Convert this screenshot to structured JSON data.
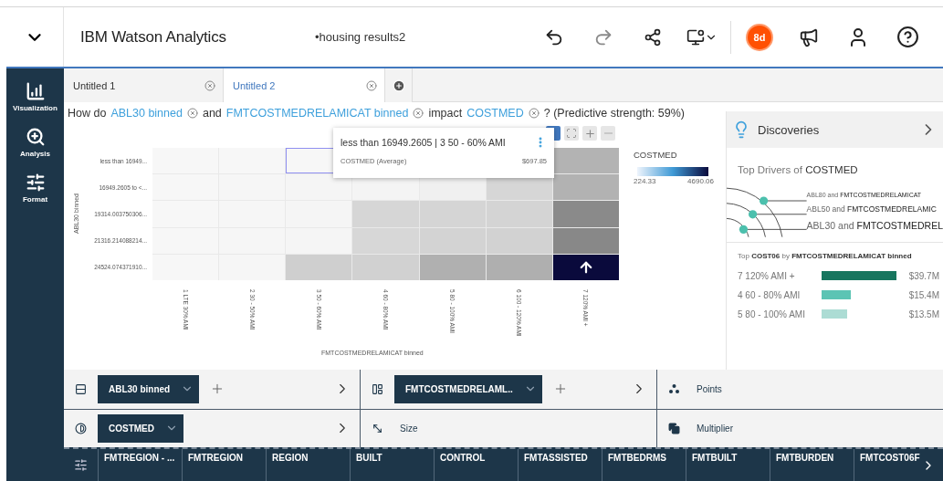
{
  "header": {
    "app_title": "IBM Watson Analytics",
    "document_title": "•housing results2",
    "badge": "8d"
  },
  "sidebar": {
    "items": [
      {
        "kind": "visualization",
        "label": "Visualization"
      },
      {
        "kind": "analysis",
        "label": "Analysis"
      },
      {
        "kind": "format",
        "label": "Format"
      }
    ]
  },
  "tabs": [
    {
      "label": "Untitled 1",
      "selected": false
    },
    {
      "label": "Untitled 2",
      "selected": true
    }
  ],
  "question": [
    {
      "kind": "text",
      "text": "How do"
    },
    {
      "kind": "token",
      "text": "ABL30 binned"
    },
    {
      "kind": "text",
      "text": "and"
    },
    {
      "kind": "token",
      "text": "FMTCOSTMEDRELAMICAT binned"
    },
    {
      "kind": "text",
      "text": "impact"
    },
    {
      "kind": "token",
      "text": "COSTMED"
    },
    {
      "kind": "text",
      "text": "? (Predictive strength: 59%)"
    }
  ],
  "heatmap": {
    "y_title": "ABL30 binned",
    "x_title": "FMTCOSTMEDRELAMICAT binned",
    "columns": [
      "1 LTE 30% AMI",
      "2 30 - 50% AMI",
      "3 50 - 60% AMI",
      "4 60 - 80% AMI",
      "5 80 - 100% AMI",
      "6 100 - 120% AMI",
      "7 120% AMI +"
    ],
    "rows": [
      {
        "label": "less than 16949...",
        "cells": [
          {
            "kind": "plain",
            "color": "#f7f7f7"
          },
          {
            "kind": "plain",
            "color": "#f7f7f7"
          },
          {
            "kind": "selected",
            "color": "#f7f7f7"
          },
          {
            "kind": "covered"
          },
          {
            "kind": "covered"
          },
          {
            "kind": "covered"
          },
          {
            "kind": "plain",
            "color": "#b3b3b3"
          }
        ]
      },
      {
        "label": "16949.2605 to <...",
        "cells": [
          {
            "kind": "plain",
            "color": "#f7f7f7"
          },
          {
            "kind": "plain",
            "color": "#f6f6f6"
          },
          {
            "kind": "plain",
            "color": "#f5f5f5"
          },
          {
            "kind": "plain",
            "color": "#f4f4f4"
          },
          {
            "kind": "plain",
            "color": "#f0f0f0"
          },
          {
            "kind": "plain",
            "color": "#d6d6d6"
          },
          {
            "kind": "plain",
            "color": "#b2b2b2"
          }
        ]
      },
      {
        "label": "19314.003750306...",
        "cells": [
          {
            "kind": "plain",
            "color": "#f7f7f7"
          },
          {
            "kind": "plain",
            "color": "#f6f6f6"
          },
          {
            "kind": "plain",
            "color": "#f5f5f5"
          },
          {
            "kind": "plain",
            "color": "#d6d6d6"
          },
          {
            "kind": "plain",
            "color": "#d5d5d5"
          },
          {
            "kind": "plain",
            "color": "#d4d4d4"
          },
          {
            "kind": "plain",
            "color": "#8a8a8a"
          }
        ]
      },
      {
        "label": "21316.214088214...",
        "cells": [
          {
            "kind": "plain",
            "color": "#f7f7f7"
          },
          {
            "kind": "plain",
            "color": "#f6f6f6"
          },
          {
            "kind": "plain",
            "color": "#f5f5f5"
          },
          {
            "kind": "plain",
            "color": "#d7d7d7"
          },
          {
            "kind": "plain",
            "color": "#d3d3d3"
          },
          {
            "kind": "plain",
            "color": "#d2d2d2"
          },
          {
            "kind": "plain",
            "color": "#888888"
          }
        ]
      },
      {
        "label": "24524.074371910...",
        "cells": [
          {
            "kind": "plain",
            "color": "#f7f7f7"
          },
          {
            "kind": "plain",
            "color": "#f6f6f6"
          },
          {
            "kind": "plain",
            "color": "#cfcfcf"
          },
          {
            "kind": "plain",
            "color": "#d1d1d1"
          },
          {
            "kind": "plain",
            "color": "#b0b0b0"
          },
          {
            "kind": "plain",
            "color": "#afafaf"
          },
          {
            "kind": "arrow",
            "color": "#0a0a3c"
          }
        ]
      }
    ]
  },
  "legend": {
    "title": "COSTMED",
    "min": "224.33",
    "max": "4690.06"
  },
  "tooltip": {
    "title": "less than 16949.2605 | 3 50 - 60% AMI",
    "measure": "COSTMED (Average)",
    "value": "$697.85"
  },
  "discoveries": {
    "title": "Discoveries",
    "drivers_title": "Top Drivers of **COSTMED**",
    "drivers": [
      "ABL80 and **FMTCOSTMEDRELAMICAT**",
      "ABL50 and **FMTCOSTMEDRELAMIC**",
      "ABL30 and **FMTCOSTMEDREL**"
    ],
    "top_title": "Top **COST06** by **FMTCOSTMEDRELAMICAT binned**",
    "bars": [
      {
        "label": "7 120% AMI +",
        "value": "$39.7M",
        "color": "#17765f"
      },
      {
        "label": "4 60 - 80% AMI",
        "value": "$15.4M",
        "color": "#5cc4b4"
      },
      {
        "label": "5 80 - 100% AMI",
        "value": "$13.5M",
        "color": "#acdcd4"
      }
    ]
  },
  "shelves": [
    [
      {
        "kind": "rows",
        "pill": "ABL30 binned",
        "addable": true,
        "expand": true
      },
      {
        "kind": "columns",
        "pill": "FMTCOSTMEDRELAML..",
        "addable": true,
        "expand": true
      },
      {
        "kind": "points",
        "label": "Points"
      }
    ],
    [
      {
        "kind": "color",
        "pill": "COSTMED",
        "addable": false,
        "expand": true
      },
      {
        "kind": "size",
        "label": "Size"
      },
      {
        "kind": "multiplier",
        "label": "Multiplier"
      }
    ]
  ],
  "fields": [
    "FMTREGION - ...",
    "FMTREGION",
    "REGION",
    "BUILT",
    "CONTROL",
    "FMTASSISTED",
    "FMTBEDRMS",
    "FMTBUILT",
    "FMTBURDEN",
    "FMTCOST06F"
  ]
}
